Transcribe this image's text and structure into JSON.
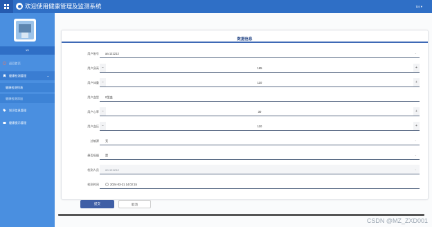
{
  "header": {
    "app_title": "欢迎使用健康管理及监测系统",
    "user_menu": "tcs ▾",
    "menu_icon": "grid-icon",
    "logo_icon": "logo-icon",
    "brand_color": "#2f6fc6"
  },
  "sidebar": {
    "avatar_icon": "avatar-image",
    "user_name": "xx",
    "items": [
      {
        "label": "返回首页",
        "icon": "home-icon"
      },
      {
        "label": "健康检测管理",
        "icon": "bookmark-icon",
        "expanded": true
      },
      {
        "label": "健康检测列表",
        "active": true
      },
      {
        "label": "健康检测添加"
      },
      {
        "label": "知识信息管理",
        "icon": "tag-icon"
      },
      {
        "label": "健康提示管理",
        "icon": "monitor-icon"
      }
    ],
    "bg_color": "#4a8fe0"
  },
  "form": {
    "title": "数据信息",
    "fields": [
      {
        "label": "用户账号",
        "value": "aa 121212"
      },
      {
        "label": "用户身高",
        "value": "165",
        "minus": "−",
        "plus": "+"
      },
      {
        "label": "用户体重",
        "value": "110",
        "minus": "−",
        "plus": "+"
      },
      {
        "label": "用户血型",
        "value": "0型血"
      },
      {
        "label": "用户心率",
        "value": "30",
        "minus": "−",
        "plus": "+"
      },
      {
        "label": "用户血压",
        "value": "110",
        "minus": "−",
        "plus": "+"
      },
      {
        "label": "过敏源",
        "value": "无"
      },
      {
        "label": "患否吸烟",
        "value": "是"
      },
      {
        "label": "检测人员",
        "value": "aa 121212"
      },
      {
        "label": "检测时间",
        "value": "2024-03-21 14:02:15"
      }
    ]
  },
  "actions": {
    "submit_label": "提交",
    "cancel_label": "取消"
  },
  "watermark": "CSDN @MZ_ZXD001"
}
